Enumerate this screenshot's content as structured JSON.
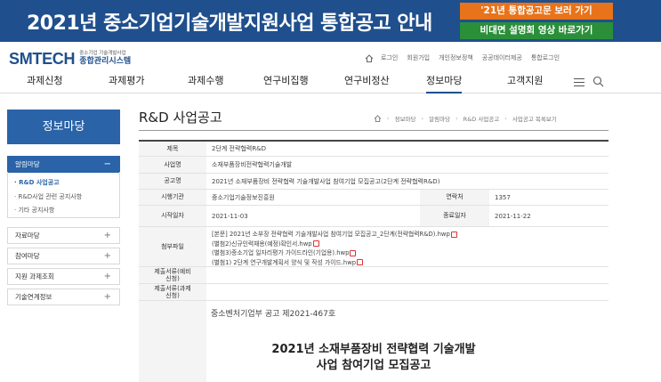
{
  "banner": {
    "title": "2021년 중소기업기술개발지원사업 통합공고 안내",
    "btn_orange": "'21년 통합공고문 보러 가기",
    "btn_green": "비대면 설명회 영상 바로가기",
    "orange_color": "#e8731a",
    "green_color": "#2b8f3a",
    "bg_color": "#1f4f8d"
  },
  "header": {
    "logo_main": "SMTECH",
    "logo_sub1": "중소기업 기술개발사업",
    "logo_sub2": "종합관리시스템",
    "util": {
      "home_icon": "home-icon",
      "login": "로그인",
      "join": "회원가입",
      "privacy": "개인정보정책",
      "public_data": "공공데이터제공",
      "integrated_login": "통합로그인"
    }
  },
  "gnb": {
    "items": [
      "과제신청",
      "과제평가",
      "과제수행",
      "연구비집행",
      "연구비정산",
      "정보마당",
      "고객지원"
    ],
    "active": "정보마당",
    "menu_icon": "hamburger-icon",
    "search_icon": "search-icon"
  },
  "sidebar": {
    "title": "정보마당",
    "categories": [
      {
        "label": "알림마당",
        "toggle": "−"
      },
      {
        "label": "자료마당",
        "toggle": "+"
      },
      {
        "label": "참여마당",
        "toggle": "+"
      },
      {
        "label": "지원 과제조회",
        "toggle": "+"
      },
      {
        "label": "기술연계정보",
        "toggle": "+"
      }
    ],
    "sub_items": [
      "· R&D 사업공고",
      "· R&D사업 관련 공지사항",
      "· 기타 공지사항"
    ]
  },
  "content": {
    "page_title": "R&D 사업공고",
    "breadcrumb": [
      "정보마당",
      "알림마당",
      "R&D 사업공고",
      "사업공고 목록보기"
    ],
    "table": {
      "title_label": "제목",
      "title_value": "2단계 전략협력R&D",
      "business_label": "사업명",
      "business_value": "소재부품장비전략협력기술개발",
      "notice_label": "공고명",
      "notice_value": "2021년 소재부품장비 전략협력 기술개발사업 참여기업 모집공고(2단계 전략협력R&D)",
      "agency_label": "시행기관",
      "agency_value": "중소기업기술정보진흥원",
      "year_label": "연락처",
      "year_value": "1357",
      "start_label": "시작일자",
      "start_value": "2021-11-03",
      "end_label": "종료일자",
      "end_value": "2021-11-22",
      "attach_label": "첨부파일",
      "attachments": [
        "[본문] 2021년 소부장 전략협력 기술개발사업 참여기업 모집공고_2단계(전략협력R&D).hwp",
        "(별첨2)신규인력채용(예정)확인서.hwp",
        "(별첨3)중소기업 일자리평가 가이드라인(기업용).hwp",
        "(별첨1) 2단계 연구개발계획서 양식 및 작성 가이드.hwp"
      ],
      "submit1_label": "제출서류(예비신청)",
      "submit2_label": "제출서류(과제신청)"
    },
    "notice_number": "중소벤처기업부 공고 제2021-467호",
    "doc_title_line1": "2021년 소재부품장비 전략협력 기술개발",
    "doc_title_line2": "사업 참여기업 모집공고"
  }
}
